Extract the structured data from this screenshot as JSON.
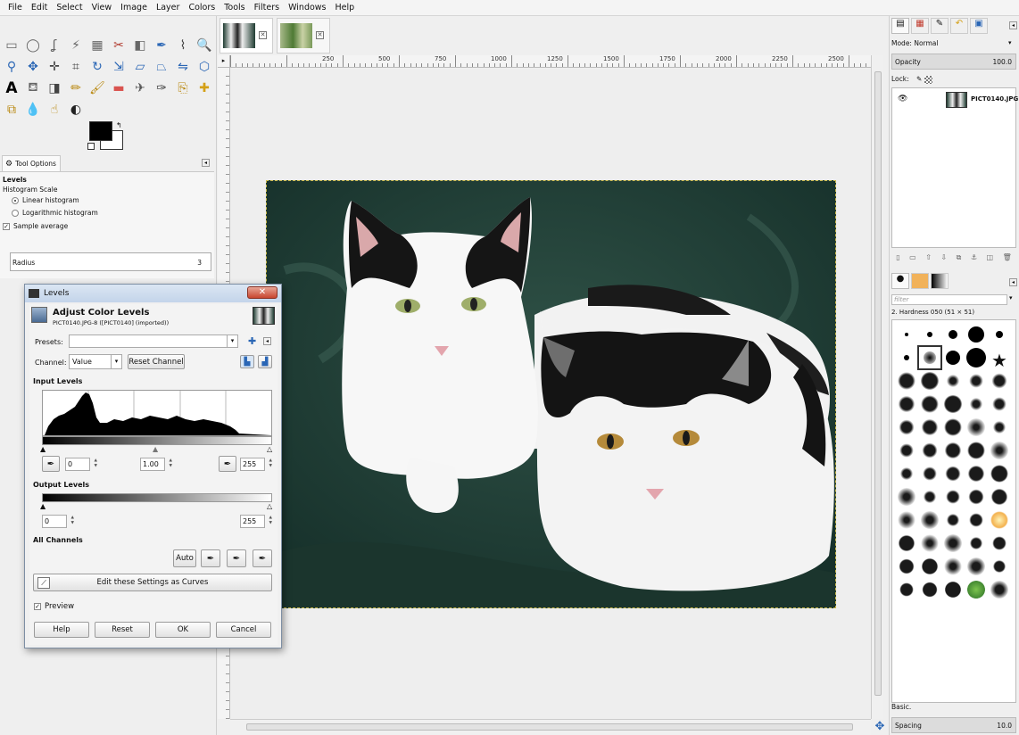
{
  "menubar": [
    "File",
    "Edit",
    "Select",
    "View",
    "Image",
    "Layer",
    "Colors",
    "Tools",
    "Filters",
    "Windows",
    "Help"
  ],
  "toolbox": {
    "tools": [
      "rect-select-icon",
      "ellipse-select-icon",
      "free-select-icon",
      "fuzzy-select-icon",
      "select-by-color-icon",
      "scissors-icon",
      "foreground-select-icon",
      "paths-icon",
      "color-picker-icon",
      "zoom-icon",
      "measure-icon",
      "move-icon",
      "align-icon",
      "crop-icon",
      "rotate-icon",
      "scale-icon",
      "shear-icon",
      "perspective-icon",
      "flip-icon",
      "cage-icon",
      "text-icon",
      "bucket-fill-icon",
      "blend-icon",
      "pencil-icon",
      "paintbrush-icon",
      "eraser-icon",
      "airbrush-icon",
      "ink-icon",
      "clone-icon",
      "heal-icon",
      "perspective-clone-icon",
      "blur-icon",
      "smudge-icon",
      "dodge-burn-icon"
    ],
    "tool_options_tab": "Tool Options",
    "tool_name": "Levels",
    "histogram_scale_label": "Histogram Scale",
    "linear_label": "Linear histogram",
    "log_label": "Logarithmic histogram",
    "sample_average_label": "Sample average",
    "radius_label": "Radius",
    "radius_value": "3"
  },
  "ruler_ticks": [
    "250",
    "500",
    "750",
    "1000",
    "1250",
    "1500",
    "1750",
    "2000",
    "2250",
    "2500"
  ],
  "levels_dialog": {
    "window_title": "Levels",
    "heading": "Adjust Color Levels",
    "subheading": "PICT0140.JPG-8 ([PICT0140] (imported))",
    "presets_label": "Presets:",
    "channel_label": "Channel:",
    "channel_value": "Value",
    "reset_channel": "Reset Channel",
    "input_levels": "Input Levels",
    "input_low": "0",
    "input_gamma": "1.00",
    "input_high": "255",
    "output_levels": "Output Levels",
    "output_low": "0",
    "output_high": "255",
    "all_channels": "All Channels",
    "auto": "Auto",
    "edit_curves": "Edit these Settings as Curves",
    "preview": "Preview",
    "help": "Help",
    "reset": "Reset",
    "ok": "OK",
    "cancel": "Cancel"
  },
  "layers_dock": {
    "mode_label": "Mode: Normal",
    "opacity_label": "Opacity",
    "opacity_value": "100.0",
    "lock_label": "Lock:",
    "layer_name": "PICT0140.JPG"
  },
  "brushes_dock": {
    "filter_placeholder": "filter",
    "brush_name": "2. Hardness 050 (51 × 51)",
    "preset": "Basic.",
    "spacing_label": "Spacing",
    "spacing_value": "10.0"
  }
}
